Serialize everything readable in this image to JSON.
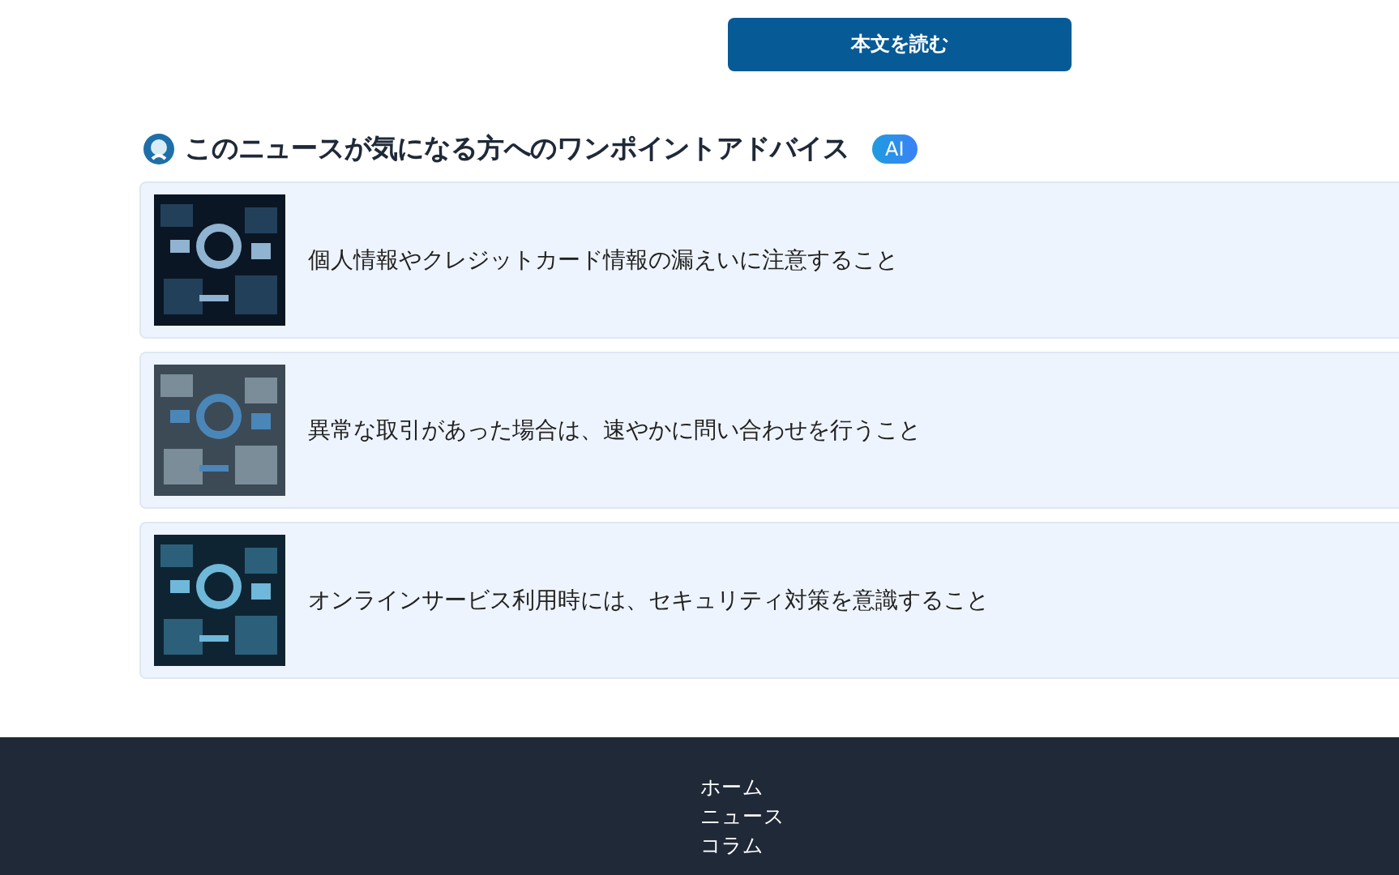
{
  "read_button": {
    "label": "本文を読む"
  },
  "advice": {
    "title": "このニュースが気になる方へのワンポイントアドバイス",
    "badge": "AI",
    "items": [
      {
        "text": "個人情報やクレジットカード情報の漏えいに注意すること"
      },
      {
        "text": "異常な取引があった場合は、速やかに問い合わせを行うこと"
      },
      {
        "text": "オンラインサービス利用時には、セキュリティ対策を意識すること"
      }
    ]
  },
  "footer": {
    "links": [
      "ホーム",
      "ニュース",
      "コラム"
    ]
  }
}
